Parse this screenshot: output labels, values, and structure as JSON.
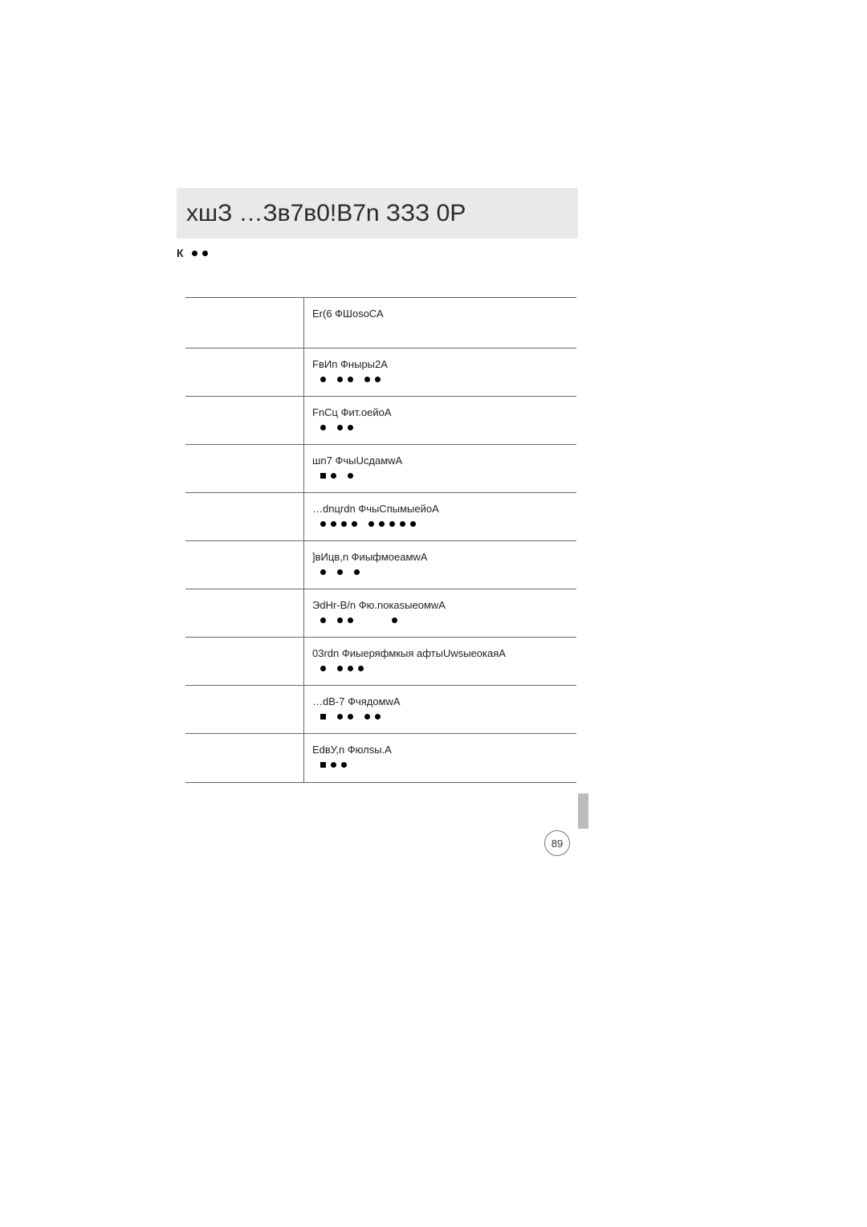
{
  "title": "хшЗ …Зв7в0!В7n ЗЗЗ 0Р",
  "sub_label": "К",
  "page_number": "89",
  "rows": [
    {
      "text": "Er(6 ФШоsоСА",
      "dots": []
    },
    {
      "text": "FвИn Фныры2А",
      "dots": [
        [
          1
        ],
        [
          1,
          1
        ],
        [
          1,
          1
        ]
      ]
    },
    {
      "text": "FnСц Фит.оейоА",
      "dots": [
        [
          1
        ],
        [
          1,
          1
        ]
      ]
    },
    {
      "text": "шn7 ФчыUсдамwА",
      "dots": [
        [
          2,
          1
        ],
        [
          1
        ]
      ]
    },
    {
      "text": "…dnцrdn ФчыСпымыейоА",
      "dots": [
        [
          1,
          1,
          1,
          1
        ],
        [
          1,
          1,
          1,
          1,
          1
        ]
      ]
    },
    {
      "text": "]вИцв,n ФиыфмоеамwА",
      "dots": [
        [
          1
        ],
        [
          1
        ],
        [
          1
        ]
      ]
    },
    {
      "text": "ЭdHr-B/n Фю.nокаsыеомwА",
      "dots": [
        [
          1
        ],
        [
          1,
          1
        ],
        [],
        [
          1
        ]
      ]
    },
    {
      "text": "03rdn Фиыеряфмкыя афтыUwsыеокаяА",
      "dots": [
        [
          1
        ],
        [
          1,
          1,
          1
        ]
      ]
    },
    {
      "text": "…dB-7 ФчядомwА",
      "dots": [
        [
          2
        ],
        [
          1,
          1
        ],
        [
          1,
          1
        ]
      ]
    },
    {
      "text": "ЕdвУ,n Фюлsы.А",
      "dots": [
        [
          2,
          1,
          1
        ]
      ]
    }
  ]
}
